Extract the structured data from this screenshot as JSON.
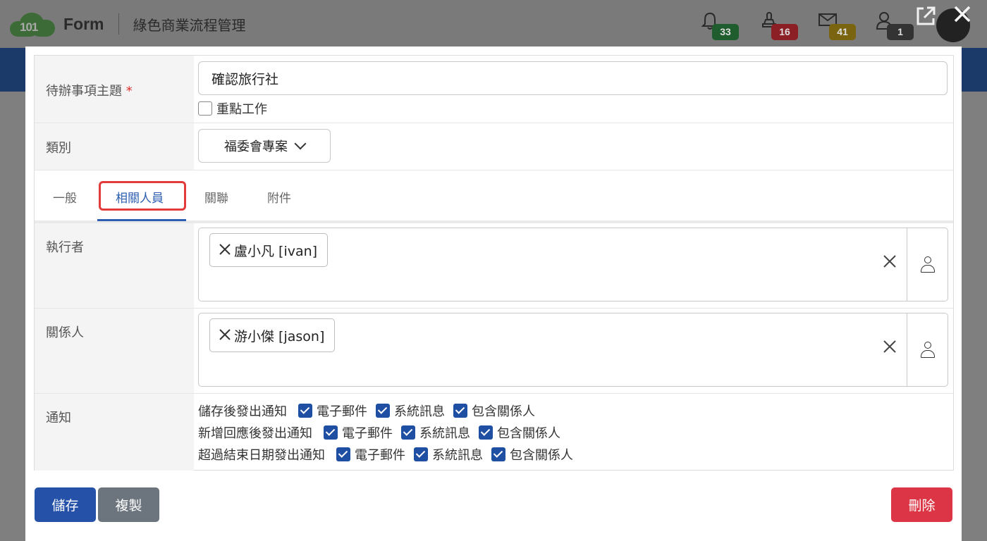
{
  "header": {
    "logo_number": "101",
    "logo_text": "Form",
    "app_subtitle": "綠色商業流程管理",
    "badges": [
      {
        "icon": "bell-icon",
        "count": "33",
        "color": "#1f5c2e"
      },
      {
        "icon": "stamp-icon",
        "count": "16",
        "color": "#8b1f25"
      },
      {
        "icon": "mail-icon",
        "count": "41",
        "color": "#7a6410"
      },
      {
        "icon": "user-icon",
        "count": "1",
        "color": "#333333"
      }
    ]
  },
  "form": {
    "subject_label": "待辦事項主題",
    "required_mark": "*",
    "subject_value": "確認旅行社",
    "important_label": "重點工作",
    "important_checked": false,
    "category_label": "類別",
    "category_value": "福委會專案"
  },
  "tabs": [
    {
      "label": "一般",
      "active": false
    },
    {
      "label": "相關人員",
      "active": true
    },
    {
      "label": "關聯",
      "active": false
    },
    {
      "label": "附件",
      "active": false
    }
  ],
  "people": {
    "executor_label": "執行者",
    "executor_tag": "盧小凡 [ivan]",
    "related_label": "關係人",
    "related_tag": "游小傑 [jason]"
  },
  "notify": {
    "label": "通知",
    "lines": [
      {
        "text": "儲存後發出通知",
        "options": [
          "電子郵件",
          "系統訊息",
          "包含關係人"
        ]
      },
      {
        "text": "新增回應後發出通知",
        "options": [
          "電子郵件",
          "系統訊息",
          "包含關係人"
        ]
      },
      {
        "text": "超過結束日期發出通知",
        "options": [
          "電子郵件",
          "系統訊息",
          "包含關係人"
        ]
      }
    ]
  },
  "buttons": {
    "save": "儲存",
    "copy": "複製",
    "delete": "刪除"
  },
  "colors": {
    "primary": "#2552a8",
    "secondary": "#6c757d",
    "danger": "#dc3545",
    "tab_highlight": "#e23b3b"
  }
}
